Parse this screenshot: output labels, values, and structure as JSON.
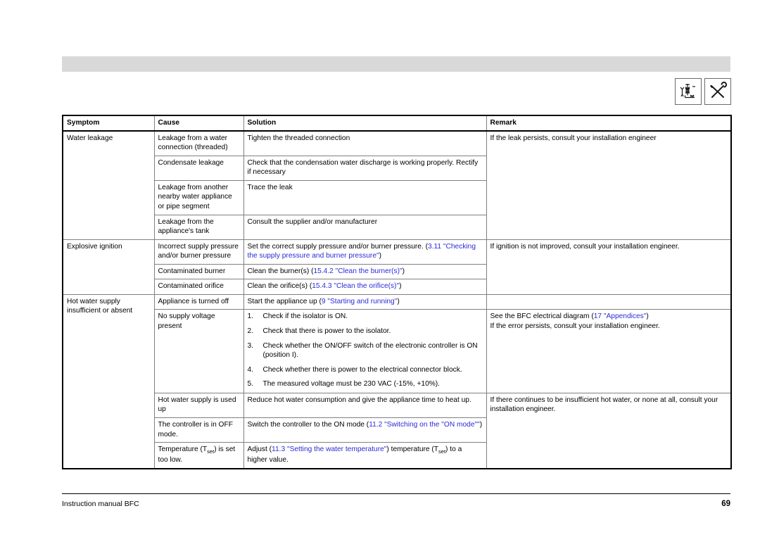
{
  "header": {
    "band_color": "#d9d9d9"
  },
  "icons": [
    {
      "name": "gas-piping-diagram-icon",
      "label": "Gas piping diagram"
    },
    {
      "name": "crossed-tools-icon",
      "label": "Wrench and screwdriver"
    }
  ],
  "table": {
    "columns": [
      "Symptom",
      "Cause",
      "Solution",
      "Remark"
    ],
    "link_color": "#2b2bd6",
    "groups": [
      {
        "symptom": "Water leakage",
        "remark": "If the leak persists, consult your installation engineer",
        "rows": [
          {
            "cause": "Leakage from a water connection (threaded)",
            "solution": "Tighten the threaded connection"
          },
          {
            "cause": "Condensate leakage",
            "solution": "Check that the condensation water discharge is working properly. Rectify if necessary"
          },
          {
            "cause": "Leakage from another nearby water appliance or pipe segment",
            "solution": "Trace the leak"
          },
          {
            "cause": "Leakage from the appliance's tank",
            "solution": "Consult the supplier and/or manufacturer"
          }
        ]
      },
      {
        "symptom": "Explosive ignition",
        "remark": "If ignition is not improved, consult your installation engineer.",
        "rows": [
          {
            "cause": "Incorrect supply pressure and/or burner pressure",
            "solution_pre": "Set the correct supply pressure and/or burner pressure. (",
            "solution_link": "3.11 \"Checking the supply pressure and burner pressure\"",
            "solution_post": ")"
          },
          {
            "cause": "Contaminated burner",
            "solution_pre": "Clean the burner(s) (",
            "solution_link": "15.4.2 \"Clean the burner(s)\"",
            "solution_post": ")"
          },
          {
            "cause": "Contaminated orifice",
            "solution_pre": "Clean the orifice(s) (",
            "solution_link": "15.4.3 \"Clean the orifice(s)\"",
            "solution_post": ")"
          }
        ]
      },
      {
        "symptom": "Hot water supply insufficient or absent",
        "rows": [
          {
            "cause": "Appliance is turned off",
            "solution_pre": "Start the appliance up (",
            "solution_link": "9 \"Starting and running\"",
            "solution_post": ")",
            "remark": ""
          },
          {
            "cause": "No supply voltage present",
            "steps": [
              "Check if the isolator is ON.",
              "Check that there is power to the isolator.",
              "Check whether the ON/OFF switch of the electronic controller is ON (position I).",
              "Check whether there is power to the electrical connector block.",
              "The measured voltage must be 230 VAC (-15%, +10%)."
            ],
            "remark_line1_pre": "See the BFC electrical diagram (",
            "remark_line1_link": "17 \"Appendices\"",
            "remark_line1_post": ")",
            "remark_line2": "If the error persists, consult your installation engineer."
          },
          {
            "cause": "Hot water supply is used up",
            "solution": "Reduce hot water consumption and give the appliance time to heat up.",
            "remark": "If there continues to be insufficient hot water, or none at all, consult your installation engineer."
          },
          {
            "cause": "The controller is in OFF mode.",
            "solution_pre": "Switch the controller to the ON mode (",
            "solution_link": "11.2 \"Switching on the \"ON mode\"\"",
            "solution_post": ")"
          },
          {
            "cause_pre": "Temperature (T",
            "cause_sub": "set",
            "cause_post": ") is set too low.",
            "solution_pre": "Adjust (",
            "solution_link": "11.3 \"Setting the water temperature\"",
            "solution_mid": ") temperature (T",
            "solution_sub": "set",
            "solution_post": ") to a higher value."
          }
        ]
      }
    ]
  },
  "footer": {
    "manual": "Instruction manual BFC",
    "page_number": "69"
  }
}
